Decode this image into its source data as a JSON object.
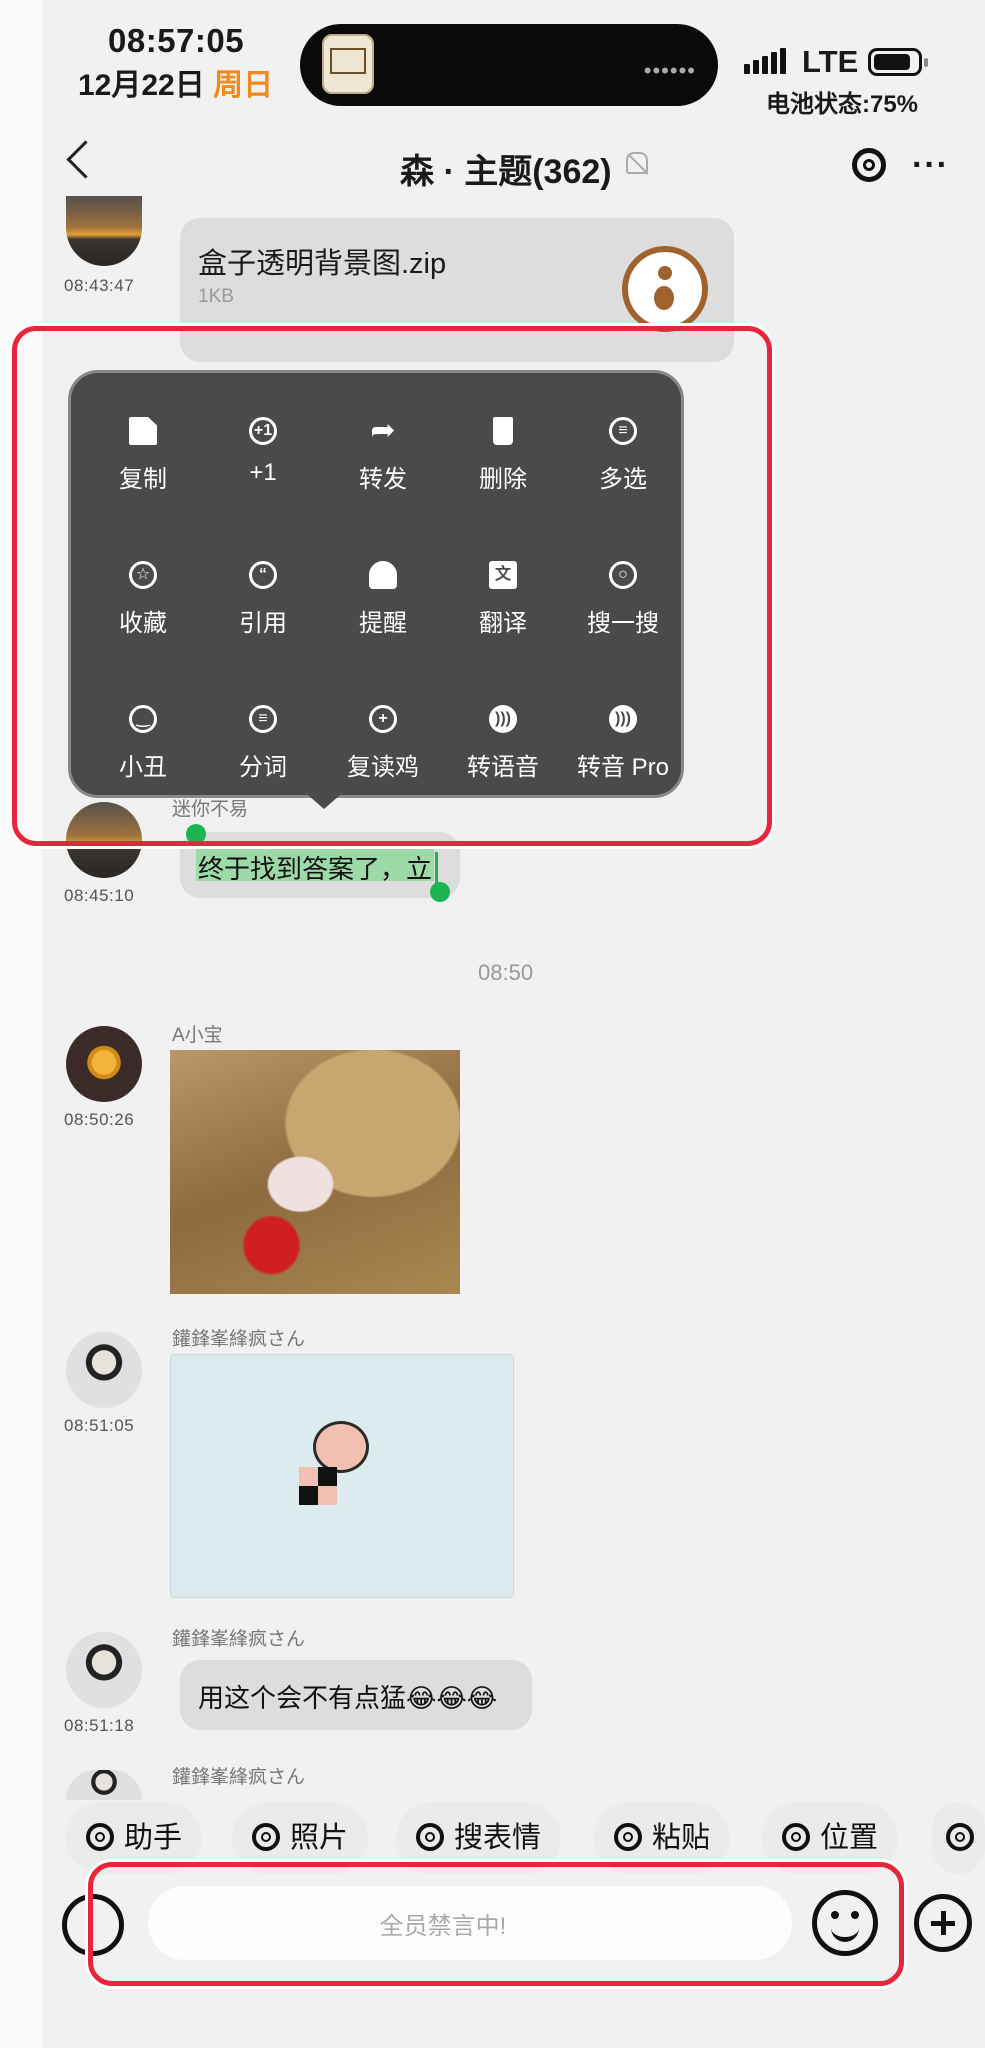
{
  "status_bar": {
    "time": "08:57:05",
    "date": "12月22日",
    "weekday": "周日",
    "network": "LTE",
    "battery_text": "电池状态:75%"
  },
  "header": {
    "title": "森 · 主题(362)"
  },
  "messages": {
    "file": {
      "time": "08:43:47",
      "name": "盒子透明背景图.zip",
      "size": "1KB"
    },
    "selected": {
      "sender": "迷你不易",
      "time": "08:45:10",
      "text": "终于找到答案了，立"
    },
    "date_separator": "08:50",
    "photo": {
      "sender": "A小宝",
      "time": "08:50:26"
    },
    "sticker": {
      "sender": "鑵鋒峯綘疯さん",
      "time": "08:51:05"
    },
    "text_msg": {
      "sender": "鑵鋒峯綘疯さん",
      "time": "08:51:18",
      "text": "用这个会不有点猛😂😂😂"
    },
    "partial": {
      "sender": "鑵鋒峯綘疯さん"
    }
  },
  "popup_menu": {
    "items": [
      {
        "label": "复制",
        "icon": "copy-icon"
      },
      {
        "label": "+1",
        "icon": "plus-one-icon"
      },
      {
        "label": "转发",
        "icon": "forward-icon"
      },
      {
        "label": "删除",
        "icon": "delete-icon"
      },
      {
        "label": "多选",
        "icon": "multi-select-icon"
      },
      {
        "label": "收藏",
        "icon": "favorite-icon"
      },
      {
        "label": "引用",
        "icon": "quote-icon"
      },
      {
        "label": "提醒",
        "icon": "bell-icon"
      },
      {
        "label": "翻译",
        "icon": "translate-icon"
      },
      {
        "label": "搜一搜",
        "icon": "search-icon"
      },
      {
        "label": "小丑",
        "icon": "smiley-icon"
      },
      {
        "label": "分词",
        "icon": "segment-icon"
      },
      {
        "label": "复读鸡",
        "icon": "repeat-icon"
      },
      {
        "label": "转语音",
        "icon": "voice-icon"
      },
      {
        "label": "转音 Pro",
        "icon": "voice-pro-icon"
      }
    ]
  },
  "toolbar": {
    "chips": [
      "助手",
      "照片",
      "搜表情",
      "粘贴",
      "位置"
    ]
  },
  "input": {
    "placeholder": "全员禁言中!"
  },
  "colors": {
    "highlight": "#e8263b",
    "weekday": "#f08a1c",
    "selection": "#9ed9a8",
    "popup_bg": "#4a4a4a"
  }
}
